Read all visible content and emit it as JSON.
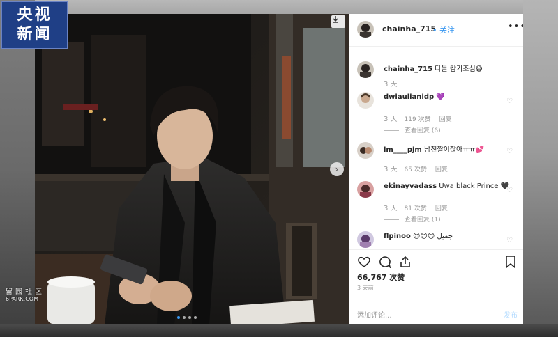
{
  "broadcast_logo": {
    "line1": "央视",
    "line2": "新闻"
  },
  "watermark": {
    "line1": "留园社区",
    "line2": "6PARK.COM"
  },
  "post": {
    "username": "chainha_715",
    "separator": "•",
    "follow_label": "关注",
    "more_icon": "more-horizontal-icon",
    "caption": {
      "user": "chainha_715",
      "text": "다들 캄기조심😷",
      "time": "3 天"
    },
    "comments": [
      {
        "user": "dwiaulianidp",
        "text": "💜",
        "time": "3 天",
        "likes": "119 次赞",
        "reply_label": "回复",
        "view_replies": "查看回复 (6)"
      },
      {
        "user": "lm____pjm",
        "text": "남친짤이잖아ㅠㅠ💕",
        "time": "3 天",
        "likes": "65 次赞",
        "reply_label": "回复",
        "view_replies": ""
      },
      {
        "user": "ekinayvadass",
        "text": "Uwa black Prince 🖤",
        "time": "3 天",
        "likes": "81 次赞",
        "reply_label": "回复",
        "view_replies": "查看回复 (1)"
      },
      {
        "user": "flpinoo",
        "text": "😍😍😍 جميل",
        "time": "",
        "likes": "",
        "reply_label": "",
        "view_replies": ""
      }
    ],
    "like_count": "66,767 次赞",
    "posted_ago": "3 天前",
    "add_comment_placeholder": "添加评论...",
    "post_label": "发布",
    "colors": {
      "link": "#3897f0",
      "text": "#262626",
      "muted": "#999999"
    }
  }
}
